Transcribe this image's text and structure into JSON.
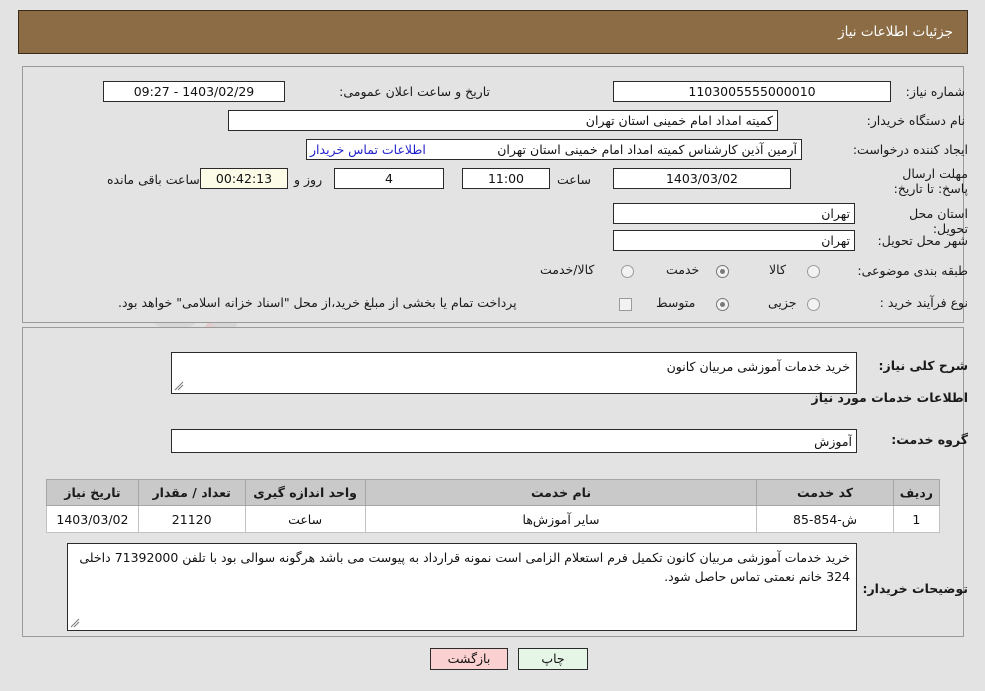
{
  "header": {
    "title": "جزئیات اطلاعات نیاز",
    "bg_color": "#8c6c45",
    "text_color": "#ffffff"
  },
  "top_section": {
    "need_number_label": "شماره نیاز:",
    "need_number_value": "1103005555000010",
    "announce_datetime_label": "تاریخ و ساعت اعلان عمومی:",
    "announce_datetime_value": "1403/02/29 - 09:27",
    "buyer_org_label": "نام دستگاه خریدار:",
    "buyer_org_value": "کمیته امداد امام خمینی استان تهران",
    "requester_label": "ایجاد کننده درخواست:",
    "requester_value": "آرمین آذین کارشناس کمیته امداد امام خمینی استان تهران",
    "contact_link": "اطلاعات تماس خریدار",
    "deadline_label": "مهلت ارسال پاسخ: تا تاریخ:",
    "deadline_date": "1403/03/02",
    "hour_label": "ساعت",
    "hour_value": "11:00",
    "days_value": "4",
    "days_sep_label": "روز و",
    "countdown_value": "00:42:13",
    "remaining_label": "ساعت باقی مانده",
    "province_label": "استان محل تحویل:",
    "province_value": "تهران",
    "city_label": "شهر محل تحویل:",
    "city_value": "تهران",
    "category_label": "طبقه بندی موضوعی:",
    "category_options": [
      {
        "label": "کالا",
        "selected": false
      },
      {
        "label": "خدمت",
        "selected": true
      },
      {
        "label": "کالا/خدمت",
        "selected": false
      }
    ],
    "process_label": "نوع فرآیند خرید :",
    "process_options": [
      {
        "label": "جزیی",
        "selected": false
      },
      {
        "label": "متوسط",
        "selected": true
      }
    ],
    "treasury_checkbox_checked": false,
    "treasury_note": "پرداخت تمام یا بخشی از مبلغ خرید،از محل \"اسناد خزانه اسلامی\" خواهد بود."
  },
  "mid_section": {
    "general_desc_label": "شرح کلی نیاز:",
    "general_desc_value": "خرید خدمات آموزشی مربیان کانون",
    "services_heading": "اطلاعات خدمات مورد نیاز",
    "service_group_label": "گروه خدمت:",
    "service_group_value": "آموزش",
    "buyer_notes_label": "توضیحات خریدار:",
    "buyer_notes_value": "خرید خدمات آموزشی مربیان کانون تکمیل فرم استعلام الزامی است نمونه قرارداد به پیوست می باشد هرگونه سوالی بود با تلفن 71392000 داخلی 324 خانم نعمتی تماس حاصل شود."
  },
  "table": {
    "columns": [
      "ردیف",
      "کد خدمت",
      "نام خدمت",
      "واحد اندازه گیری",
      "تعداد / مقدار",
      "تاریخ نیاز"
    ],
    "rows": [
      {
        "row": "1",
        "code": "ش-854-85",
        "name": "سایر آموزش‌ها",
        "unit": "ساعت",
        "qty": "21120",
        "date": "1403/03/02"
      }
    ]
  },
  "footer": {
    "back_label": "بازگشت",
    "back_color": "#fbd0d0",
    "print_label": "چاپ",
    "print_color": "#e6f6e6"
  },
  "watermark": {
    "text": "ArtaTender.net"
  }
}
